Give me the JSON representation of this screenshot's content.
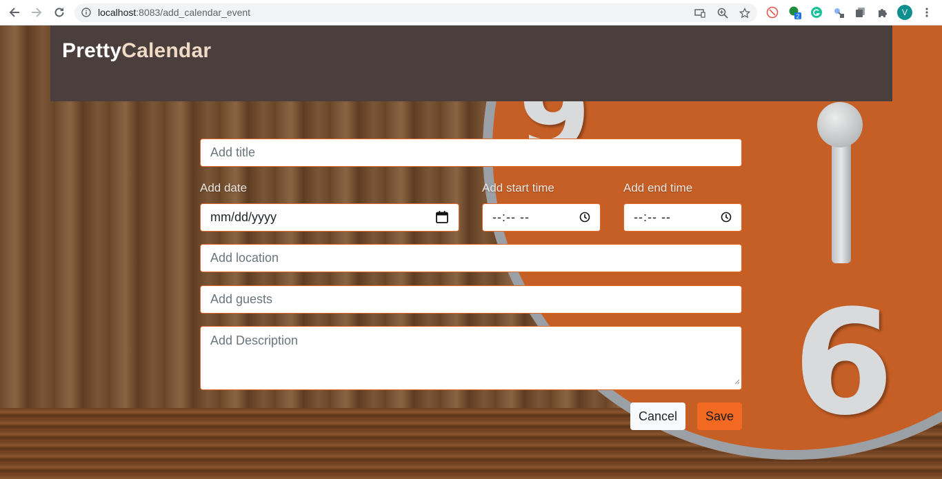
{
  "browser": {
    "url_host": "localhost",
    "url_rest": ":8083/add_calendar_event",
    "profile_initial": "V",
    "extension_badge": "2"
  },
  "header": {
    "brand_part1": "Pretty",
    "brand_part2": "Calendar"
  },
  "form": {
    "title_placeholder": "Add title",
    "date_label": "Add date",
    "date_value": "mm/dd/yyyy",
    "start_time_label": "Add start time",
    "start_time_value": "--:-- --",
    "end_time_label": "Add end time",
    "end_time_value": "--:-- --",
    "location_placeholder": "Add location",
    "guests_placeholder": "Add guests",
    "description_placeholder": "Add Description",
    "cancel_label": "Cancel",
    "save_label": "Save"
  },
  "background": {
    "clock_numbers": [
      "9",
      "6"
    ],
    "accent": "#f26a21",
    "header_color": "#4a3f3c"
  }
}
